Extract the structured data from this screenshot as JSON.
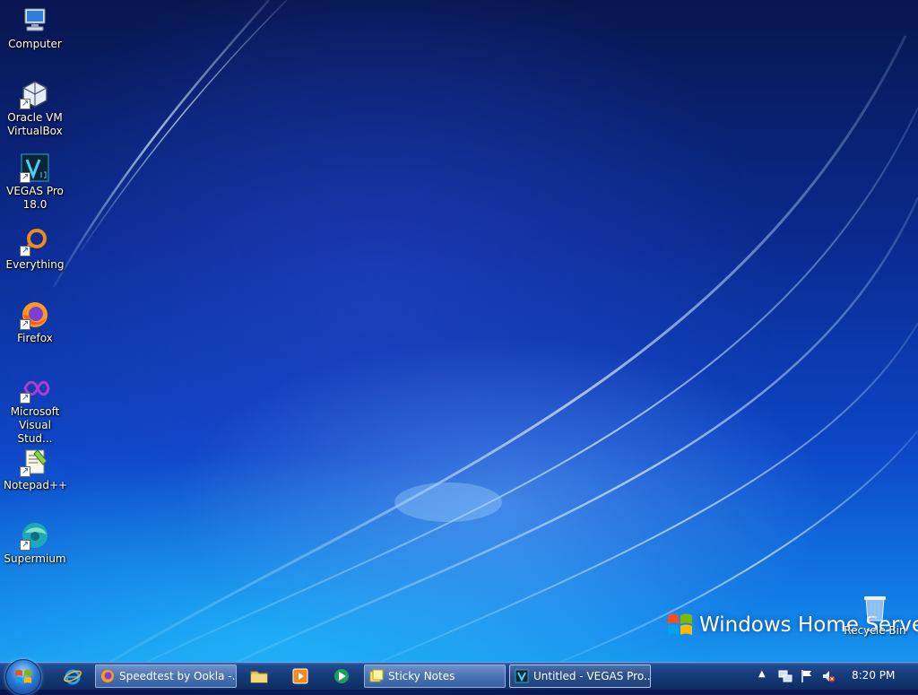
{
  "desktop": {
    "icons": [
      {
        "label": "Computer",
        "icon": "computer-icon"
      },
      {
        "label": "Oracle VM VirtualBox",
        "icon": "virtualbox-icon"
      },
      {
        "label": "VEGAS Pro 18.0",
        "icon": "vegas-pro-icon"
      },
      {
        "label": "Everything",
        "icon": "everything-search-icon"
      },
      {
        "label": "Firefox",
        "icon": "firefox-icon"
      },
      {
        "label": "Microsoft Visual Stud...",
        "icon": "visual-studio-icon"
      },
      {
        "label": "Notepad++",
        "icon": "notepad-plus-plus-icon"
      },
      {
        "label": "Supermium",
        "icon": "supermium-browser-icon"
      }
    ],
    "recycle_bin": {
      "label": "Recycle Bin",
      "icon": "recycle-bin-icon"
    },
    "wallpaper_brand": "Windows Home Server"
  },
  "taskbar": {
    "start_icon": "windows-start-orb-icon",
    "quick_launch": [
      "internet-explorer-icon",
      "file-explorer-icon",
      "media-player-icon",
      "media-center-icon"
    ],
    "buttons": [
      {
        "label": "Speedtest by Ookla -...",
        "icon": "firefox-icon",
        "active": false
      },
      {
        "label": "Sticky Notes",
        "icon": "sticky-notes-icon",
        "active": false
      },
      {
        "label": "Untitled - VEGAS Pro...",
        "icon": "vegas-pro-icon",
        "active": true
      }
    ],
    "tray": {
      "icons": [
        "show-hidden-icons-arrow",
        "network-icon",
        "action-center-flag-icon",
        "volume-muted-icon"
      ],
      "clock": "8:20 PM"
    }
  },
  "colors": {
    "taskbar": "#163a78",
    "wallpaper_top": "#07164f",
    "wallpaper_bottom": "#1aa0ef"
  }
}
